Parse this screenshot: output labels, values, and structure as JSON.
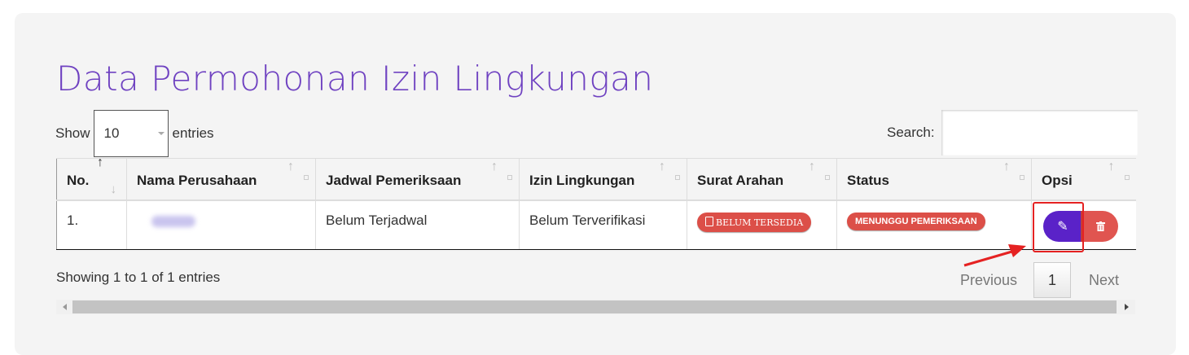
{
  "page": {
    "title": "Data Permohonan Izin Lingkungan"
  },
  "length_control": {
    "prefix": "Show",
    "value": "10",
    "suffix": "entries"
  },
  "search": {
    "label": "Search:",
    "value": ""
  },
  "table": {
    "columns": [
      "No.",
      "Nama Perusahaan",
      "Jadwal Pemeriksaan",
      "Izin Lingkungan",
      "Surat Arahan",
      "Status",
      "Opsi"
    ],
    "rows": [
      {
        "no": "1.",
        "company": "",
        "schedule": "Belum Terjadwal",
        "permit": "Belum Terverifikasi",
        "letter_badge": "BELUM TERSEDIA",
        "status_badge": "MENUNGGU PEMERIKSAAN"
      }
    ]
  },
  "footer": {
    "info": "Showing 1 to 1 of 1 entries",
    "prev": "Previous",
    "page": "1",
    "next": "Next"
  },
  "icons": {
    "edit": "pencil-icon",
    "delete": "trash-icon",
    "letter": "pdf-file-icon"
  },
  "colors": {
    "title": "#6f42c1",
    "edit_button": "#5a22c8",
    "danger": "#dc4f48",
    "highlight": "#e52222"
  }
}
